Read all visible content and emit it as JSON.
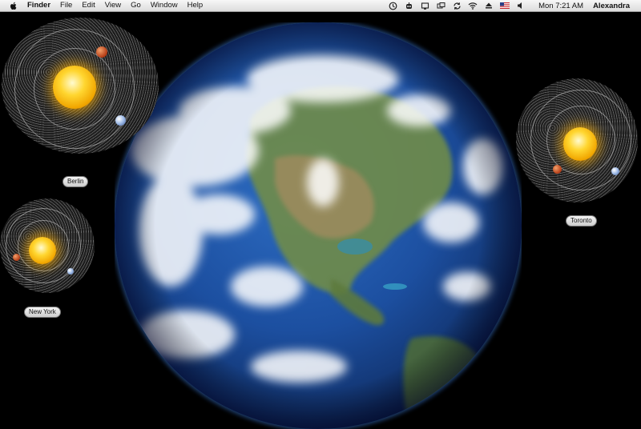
{
  "menubar": {
    "app_name": "Finder",
    "menus": [
      "File",
      "Edit",
      "View",
      "Go",
      "Window",
      "Help"
    ],
    "status_icons": [
      "time-machine-icon",
      "robot-icon",
      "screen-icon",
      "window-icon",
      "sync-icon",
      "wifi-icon",
      "eject-icon",
      "us-flag-icon",
      "volume-icon"
    ],
    "clock": "Mon 7:21 AM",
    "user": "Alexandra"
  },
  "widgets": [
    {
      "city": "Berlin"
    },
    {
      "city": "New York"
    },
    {
      "city": "Toronto"
    }
  ],
  "colors": {
    "sun": "#ffd630",
    "orbit": "#d2d2d2",
    "ocean": "#1c4fa0",
    "land": "#6f8c48"
  }
}
